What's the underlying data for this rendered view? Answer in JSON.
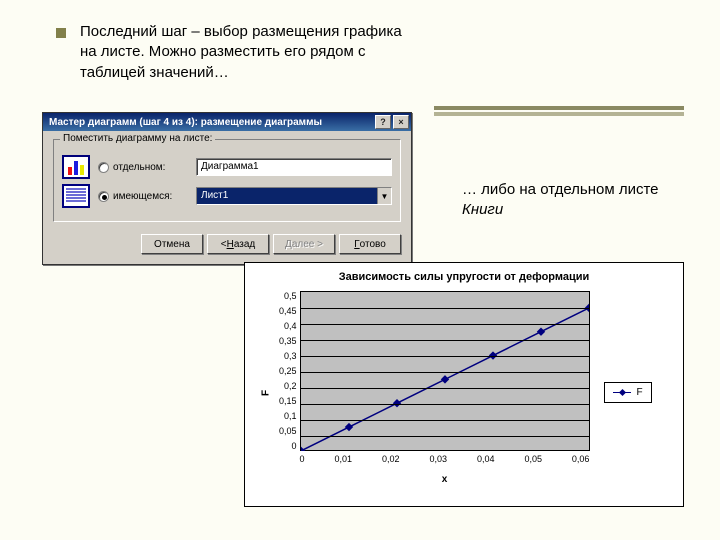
{
  "slide": {
    "text_top": "Последний шаг – выбор размещения графика на листе. Можно разместить его рядом с таблицей значений…",
    "text_right_a": "… либо на отдельном листе ",
    "text_right_b": "Книги"
  },
  "dialog": {
    "title": "Мастер диаграмм (шаг 4 из 4): размещение диаграммы",
    "help_btn": "?",
    "close_btn": "×",
    "group_label": "Поместить диаграмму на листе:",
    "radio_separate": "отдельном:",
    "radio_existing": "имеющемся:",
    "field_separate": "Диаграмма1",
    "combo_existing": "Лист1",
    "btn_cancel": "Отмена",
    "btn_back_pre": "< ",
    "btn_back_u": "Н",
    "btn_back_post": "азад",
    "btn_next_u": "Д",
    "btn_next_post": "алее >",
    "btn_finish_u": "Г",
    "btn_finish_post": "отово"
  },
  "chart_data": {
    "type": "line",
    "title": "Зависимость силы упругости от деформации",
    "xlabel": "x",
    "ylabel": "F",
    "x": [
      0,
      0.01,
      0.02,
      0.03,
      0.04,
      0.05,
      0.06
    ],
    "x_ticklabels": [
      "0",
      "0,01",
      "0,02",
      "0,03",
      "0,04",
      "0,05",
      "0,06"
    ],
    "y_ticks": [
      0,
      0.05,
      0.1,
      0.15,
      0.2,
      0.25,
      0.3,
      0.35,
      0.4,
      0.45,
      0.5
    ],
    "y_ticklabels": [
      "0,5",
      "0,45",
      "0,4",
      "0,35",
      "0,3",
      "0,25",
      "0,2",
      "0,15",
      "0,1",
      "0,05",
      "0"
    ],
    "ylim": [
      0,
      0.5
    ],
    "series": [
      {
        "name": "F",
        "values": [
          0,
          0.075,
          0.15,
          0.225,
          0.3,
          0.375,
          0.45
        ]
      }
    ],
    "legend": "F"
  }
}
